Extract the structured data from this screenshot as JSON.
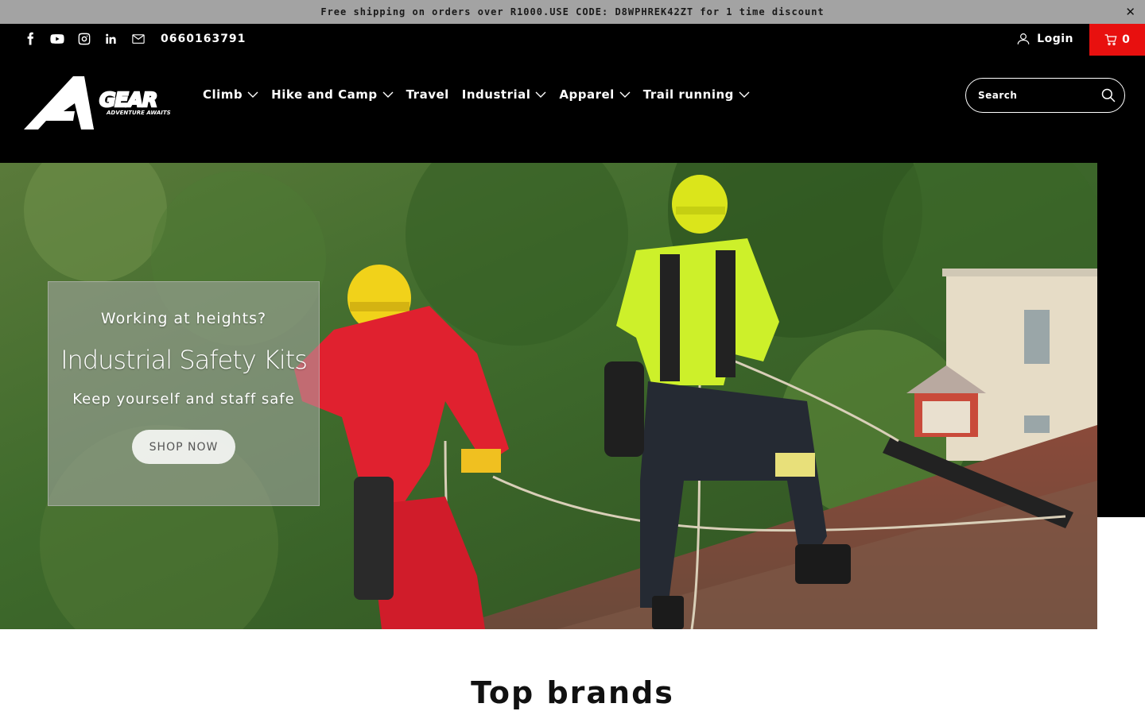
{
  "announcement": {
    "text": "Free shipping on orders over R1000.USE CODE: D8WPHREK42ZT for 1 time discount",
    "close_icon": "close-icon"
  },
  "topbar": {
    "social_icons": [
      "facebook-icon",
      "youtube-icon",
      "instagram-icon",
      "linkedin-icon",
      "mail-icon"
    ],
    "phone": "0660163791",
    "login_label": "Login",
    "cart_count": "0"
  },
  "logo": {
    "brand": "GEAR",
    "tagline": "ADVENTURE AWAITS"
  },
  "nav": {
    "items": [
      {
        "label": "Climb",
        "has_dropdown": true
      },
      {
        "label": "Hike and Camp",
        "has_dropdown": true
      },
      {
        "label": "Travel",
        "has_dropdown": false
      },
      {
        "label": "Industrial",
        "has_dropdown": true
      },
      {
        "label": "Apparel",
        "has_dropdown": true
      },
      {
        "label": "Trail running",
        "has_dropdown": true
      }
    ]
  },
  "search": {
    "placeholder": "Search"
  },
  "hero": {
    "subtitle": "Working at heights?",
    "title": "Industrial Safety Kits",
    "description": "Keep yourself and staff safe",
    "button_label": "SHOP NOW"
  },
  "section": {
    "title": "Top brands"
  },
  "colors": {
    "announcement_bg": "#a3a3a3",
    "header_bg": "#000000",
    "cart_bg": "#e8100f"
  }
}
